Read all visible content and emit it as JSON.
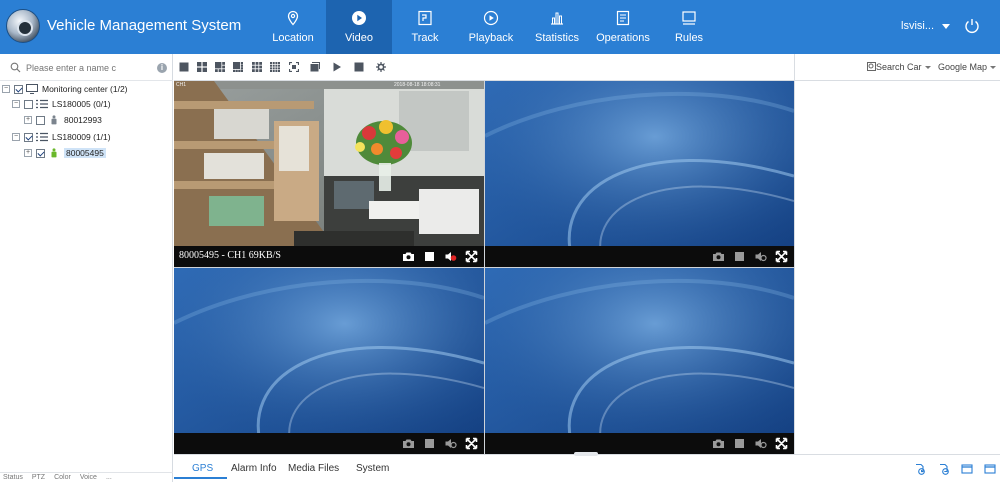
{
  "app": {
    "title": "Vehicle Management System"
  },
  "nav": [
    {
      "label": "Location",
      "icon": "location-pin-icon"
    },
    {
      "label": "Video",
      "icon": "play-circle-icon",
      "active": true
    },
    {
      "label": "Track",
      "icon": "track-icon"
    },
    {
      "label": "Playback",
      "icon": "playback-icon"
    },
    {
      "label": "Statistics",
      "icon": "bar-chart-icon"
    },
    {
      "label": "Operations",
      "icon": "operations-icon"
    },
    {
      "label": "Rules",
      "icon": "rules-icon"
    }
  ],
  "user": {
    "name": "lsvisi..."
  },
  "search": {
    "placeholder": "Please enter a name c"
  },
  "tree": {
    "root": {
      "label": "Monitoring center  (1/2)"
    },
    "groups": [
      {
        "label": "LS180005  (0/1)",
        "vehicle": "80012993"
      },
      {
        "label": "LS180009  (1/1)",
        "vehicle": "80005495"
      }
    ]
  },
  "left_tabs": [
    "Status",
    "PTZ",
    "Color",
    "Voice",
    "..."
  ],
  "map_toolbar": {
    "search_car": "Search Car",
    "map_type": "Google Map"
  },
  "video": {
    "cells": [
      {
        "label": "80005495 - CH1 69KB/S",
        "live": true
      },
      {
        "label": "",
        "live": false
      },
      {
        "label": "",
        "live": false
      },
      {
        "label": "",
        "live": false
      }
    ]
  },
  "bottom_tabs": [
    {
      "label": "GPS",
      "active": true
    },
    {
      "label": "Alarm Info"
    },
    {
      "label": "Media Files"
    },
    {
      "label": "System"
    }
  ],
  "colors": {
    "header": "#2b7fd4",
    "nav_active": "#1d64b0",
    "selected_border": "#2e9d3e"
  }
}
